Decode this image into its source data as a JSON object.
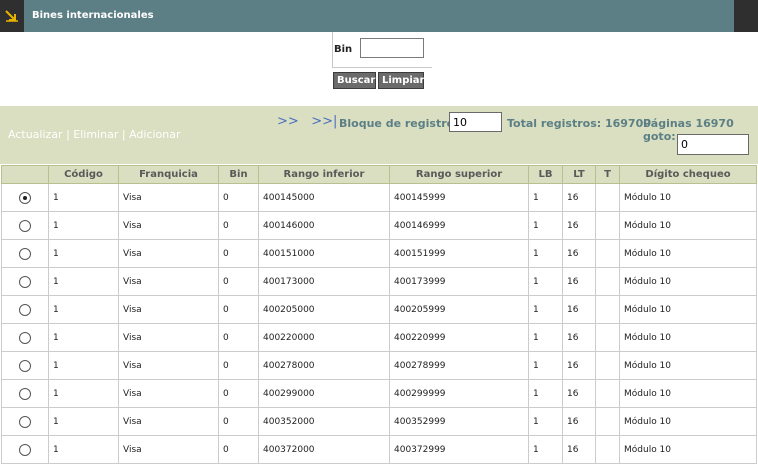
{
  "window": {
    "title": "Bines internacionales",
    "icon": "corner-arrow-icon"
  },
  "search": {
    "bin_label": "Bin",
    "bin_value": "",
    "buscar_label": "Buscar",
    "limpiar_label": "Limpiar"
  },
  "toolbar": {
    "actualizar": "Actualizar",
    "separator": "|",
    "eliminar": "Eliminar",
    "adicionar": "Adicionar",
    "next_label": ">>",
    "last_label": ">>|",
    "bloque_label": "Bloque de registros:",
    "bloque_value": "10",
    "total_label": "Total registros: 169700",
    "paginas_label": "Páginas 16970 goto:",
    "goto_value": "0"
  },
  "colors": {
    "titlebar": "#5c7f85",
    "toolbar_bg": "#d9dfc0",
    "link_blue": "#4a6fc0"
  },
  "table": {
    "headers": [
      "",
      "Código",
      "Franquicia",
      "Bin",
      "Rango inferior",
      "Rango superior",
      "LB",
      "LT",
      "T",
      "Dígito chequeo"
    ],
    "rows": [
      {
        "selected": true,
        "cells": [
          "1",
          "Visa",
          "0",
          "400145000",
          "400145999",
          "1",
          "16",
          "",
          "Módulo 10"
        ]
      },
      {
        "selected": false,
        "cells": [
          "1",
          "Visa",
          "0",
          "400146000",
          "400146999",
          "1",
          "16",
          "",
          "Módulo 10"
        ]
      },
      {
        "selected": false,
        "cells": [
          "1",
          "Visa",
          "0",
          "400151000",
          "400151999",
          "1",
          "16",
          "",
          "Módulo 10"
        ]
      },
      {
        "selected": false,
        "cells": [
          "1",
          "Visa",
          "0",
          "400173000",
          "400173999",
          "1",
          "16",
          "",
          "Módulo 10"
        ]
      },
      {
        "selected": false,
        "cells": [
          "1",
          "Visa",
          "0",
          "400205000",
          "400205999",
          "1",
          "16",
          "",
          "Módulo 10"
        ]
      },
      {
        "selected": false,
        "cells": [
          "1",
          "Visa",
          "0",
          "400220000",
          "400220999",
          "1",
          "16",
          "",
          "Módulo 10"
        ]
      },
      {
        "selected": false,
        "cells": [
          "1",
          "Visa",
          "0",
          "400278000",
          "400278999",
          "1",
          "16",
          "",
          "Módulo 10"
        ]
      },
      {
        "selected": false,
        "cells": [
          "1",
          "Visa",
          "0",
          "400299000",
          "400299999",
          "1",
          "16",
          "",
          "Módulo 10"
        ]
      },
      {
        "selected": false,
        "cells": [
          "1",
          "Visa",
          "0",
          "400352000",
          "400352999",
          "1",
          "16",
          "",
          "Módulo 10"
        ]
      },
      {
        "selected": false,
        "cells": [
          "1",
          "Visa",
          "0",
          "400372000",
          "400372999",
          "1",
          "16",
          "",
          "Módulo 10"
        ]
      }
    ]
  }
}
